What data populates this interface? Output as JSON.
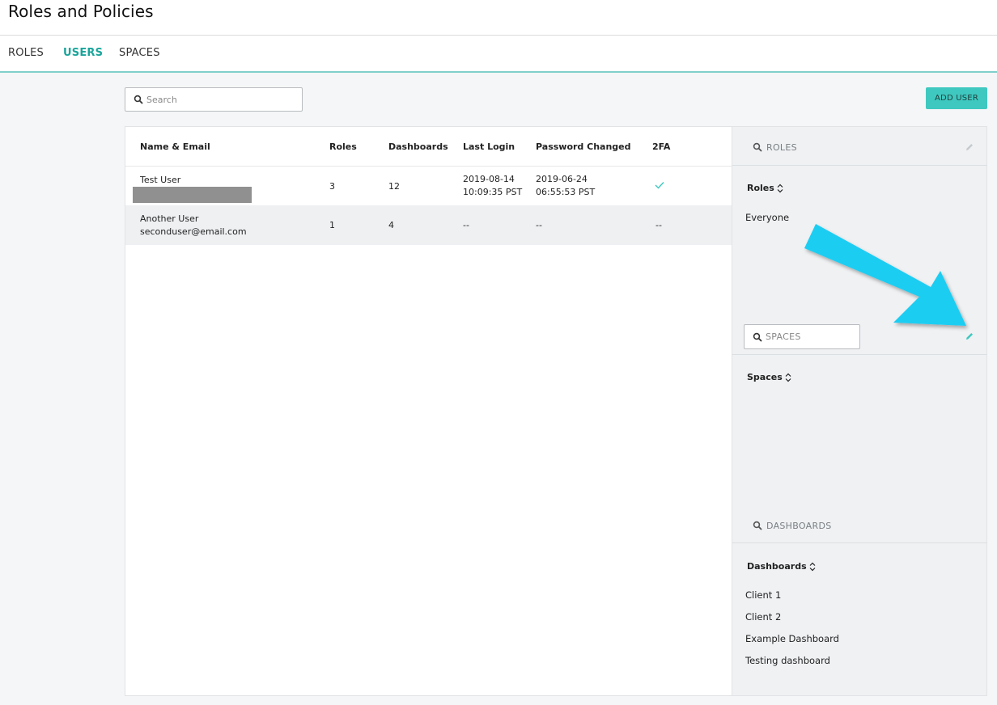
{
  "header": {
    "title": "Roles and Policies"
  },
  "tabs": [
    {
      "label": "ROLES",
      "active": false
    },
    {
      "label": "USERS",
      "active": true
    },
    {
      "label": "SPACES",
      "active": false
    }
  ],
  "search": {
    "placeholder": "Search"
  },
  "add_user_label": "ADD USER",
  "table": {
    "columns": [
      "Name & Email",
      "Roles",
      "Dashboards",
      "Last Login",
      "Password Changed",
      "2FA"
    ],
    "rows": [
      {
        "name": "Test User",
        "email_redacted": true,
        "roles": "3",
        "dashboards": "12",
        "last_login_date": "2019-08-14",
        "last_login_time": "10:09:35 PST",
        "password_changed_date": "2019-06-24",
        "password_changed_time": "06:55:53 PST",
        "twofa": "check-icon"
      },
      {
        "name": "Another User",
        "email": "seconduser@email.com",
        "roles": "1",
        "dashboards": "4",
        "last_login": "--",
        "password_changed": "--",
        "twofa": "--"
      }
    ]
  },
  "side_panel": {
    "roles": {
      "search_placeholder": "ROLES",
      "heading": "Roles",
      "items": [
        "Everyone"
      ]
    },
    "spaces": {
      "search_placeholder": "SPACES",
      "heading": "Spaces",
      "items": []
    },
    "dashboards": {
      "search_placeholder": "DASHBOARDS",
      "heading": "Dashboards",
      "items": [
        "Client 1",
        "Client 2",
        "Example Dashboard",
        "Testing dashboard"
      ]
    }
  },
  "colors": {
    "accent": "#1aa59c",
    "button_bg": "#3ec8bf",
    "annotation_arrow": "#1ccdf2",
    "redaction": "#909090"
  }
}
